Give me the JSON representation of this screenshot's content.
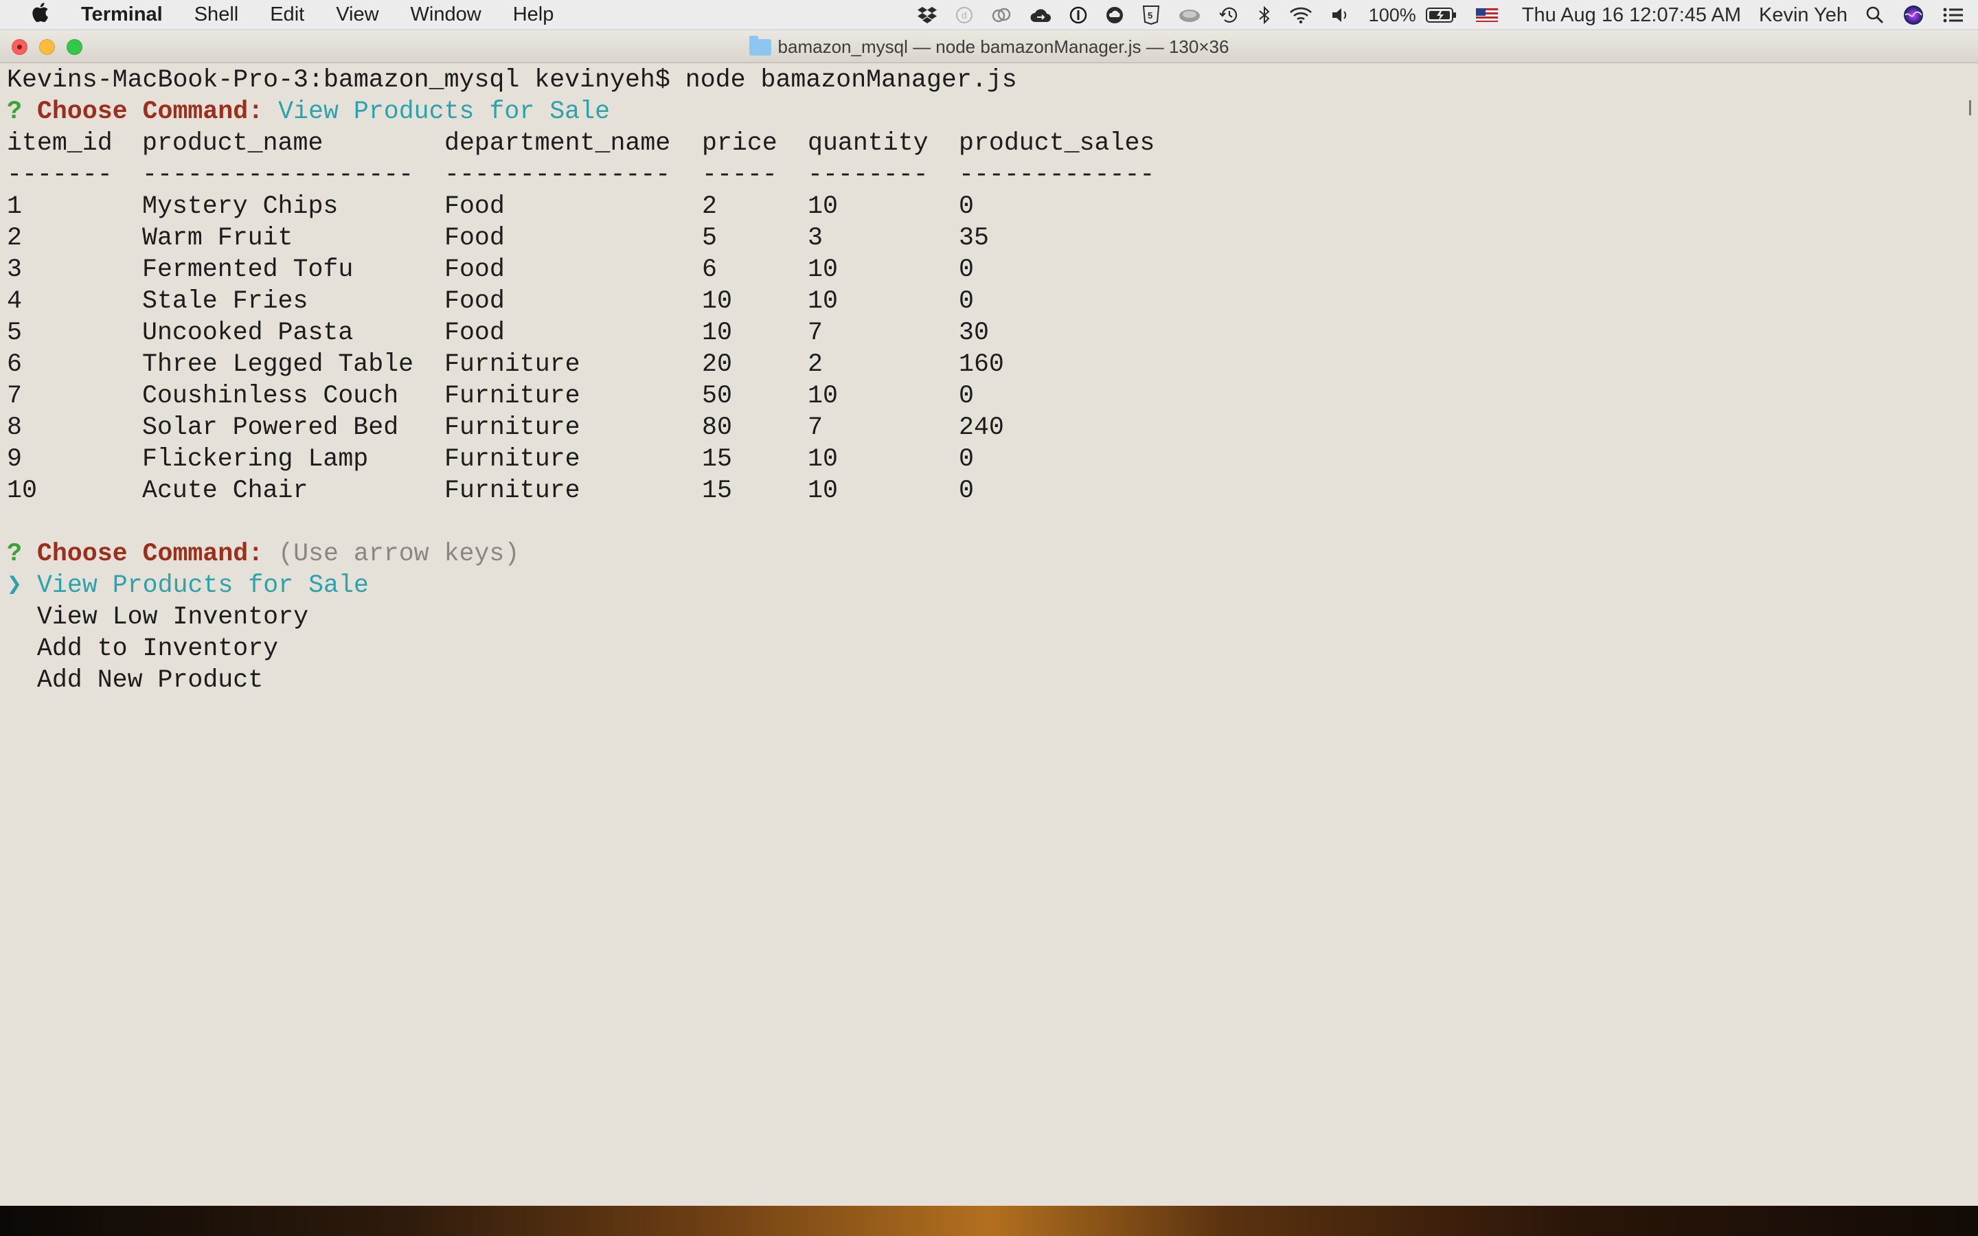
{
  "menubar": {
    "app_name": "Terminal",
    "menus": [
      "Shell",
      "Edit",
      "View",
      "Window",
      "Help"
    ],
    "battery": "100%",
    "clock": "Thu Aug 16  12:07:45 AM",
    "user": "Kevin Yeh"
  },
  "window": {
    "title": "bamazon_mysql — node bamazonManager.js — 130×36"
  },
  "terminal": {
    "prompt": "Kevins-MacBook-Pro-3:bamazon_mysql kevinyeh$ node bamazonManager.js",
    "question_mark": "?",
    "command_label": "Choose Command:",
    "first_answer": "View Products for Sale",
    "table": {
      "headers": [
        "item_id",
        "product_name",
        "department_name",
        "price",
        "quantity",
        "product_sales"
      ],
      "separators": [
        "-------",
        "------------------",
        "---------------",
        "-----",
        "--------",
        "-------------"
      ],
      "rows": [
        [
          "1",
          "Mystery Chips",
          "Food",
          "2",
          "10",
          "0"
        ],
        [
          "2",
          "Warm Fruit",
          "Food",
          "5",
          "3",
          "35"
        ],
        [
          "3",
          "Fermented Tofu",
          "Food",
          "6",
          "10",
          "0"
        ],
        [
          "4",
          "Stale Fries",
          "Food",
          "10",
          "10",
          "0"
        ],
        [
          "5",
          "Uncooked Pasta",
          "Food",
          "10",
          "7",
          "30"
        ],
        [
          "6",
          "Three Legged Table",
          "Furniture",
          "20",
          "2",
          "160"
        ],
        [
          "7",
          "Coushinless Couch",
          "Furniture",
          "50",
          "10",
          "0"
        ],
        [
          "8",
          "Solar Powered Bed",
          "Furniture",
          "80",
          "7",
          "240"
        ],
        [
          "9",
          "Flickering Lamp",
          "Furniture",
          "15",
          "10",
          "0"
        ],
        [
          "10",
          "Acute Chair",
          "Furniture",
          "15",
          "10",
          "0"
        ]
      ]
    },
    "hint": "(Use arrow keys)",
    "pointer": "❯",
    "options": [
      "View Products for Sale",
      "View Low Inventory",
      "Add to Inventory",
      "Add New Product"
    ],
    "selected_index": 0
  },
  "colors": {
    "question": "#3aa335",
    "command": "#9c2f1c",
    "answer": "#2ba3ad",
    "hint": "#8a8780",
    "background": "#e6e1d8"
  }
}
